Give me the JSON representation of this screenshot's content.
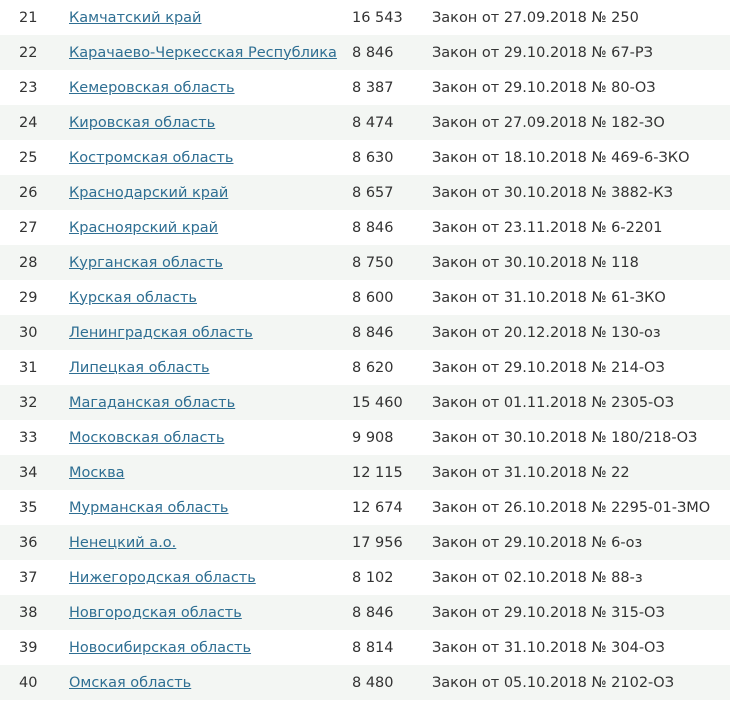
{
  "rows": [
    {
      "n": "21",
      "region": "Камчатский край",
      "amount": "16 543",
      "law": "Закон от 27.09.2018 № 250"
    },
    {
      "n": "22",
      "region": "Карачаево-Черкесская Республика",
      "amount": "8 846",
      "law": "Закон от 29.10.2018 № 67-РЗ"
    },
    {
      "n": "23",
      "region": "Кемеровская область",
      "amount": "8 387",
      "law": "Закон от 29.10.2018 № 80-ОЗ"
    },
    {
      "n": "24",
      "region": "Кировская область",
      "amount": "8 474",
      "law": "Закон от 27.09.2018 № 182-ЗО"
    },
    {
      "n": "25",
      "region": "Костромская область",
      "amount": "8 630",
      "law": "Закон от 18.10.2018 № 469-6-ЗКО"
    },
    {
      "n": "26",
      "region": "Краснодарский край",
      "amount": "8 657",
      "law": "Закон от 30.10.2018 № 3882-КЗ"
    },
    {
      "n": "27",
      "region": "Красноярский край",
      "amount": "8 846",
      "law": "Закон от 23.11.2018 № 6-2201"
    },
    {
      "n": "28",
      "region": "Курганская область",
      "amount": "8 750",
      "law": "Закон от 30.10.2018 № 118"
    },
    {
      "n": "29",
      "region": "Курская область",
      "amount": "8 600",
      "law": "Закон от 31.10.2018 № 61-ЗКО"
    },
    {
      "n": "30",
      "region": "Ленинградская область",
      "amount": "8 846",
      "law": "Закон от 20.12.2018 № 130-оз"
    },
    {
      "n": "31",
      "region": "Липецкая область",
      "amount": "8 620",
      "law": "Закон от 29.10.2018 № 214-ОЗ"
    },
    {
      "n": "32",
      "region": "Магаданская область",
      "amount": "15 460",
      "law": "Закон от 01.11.2018 № 2305-ОЗ"
    },
    {
      "n": "33",
      "region": "Московская область",
      "amount": "9 908",
      "law": "Закон от 30.10.2018 № 180/218-ОЗ"
    },
    {
      "n": "34",
      "region": "Москва",
      "amount": "12 115",
      "law": "Закон от 31.10.2018 № 22"
    },
    {
      "n": "35",
      "region": "Мурманская область",
      "amount": "12 674",
      "law": "Закон от 26.10.2018 № 2295-01-ЗМО"
    },
    {
      "n": "36",
      "region": "Ненецкий а.о.",
      "amount": "17 956",
      "law": "Закон от 29.10.2018 № 6-оз"
    },
    {
      "n": "37",
      "region": "Нижегородская область",
      "amount": "8 102",
      "law": "Закон от 02.10.2018 № 88-з"
    },
    {
      "n": "38",
      "region": "Новгородская область",
      "amount": "8 846",
      "law": "Закон от 29.10.2018 № 315-ОЗ"
    },
    {
      "n": "39",
      "region": "Новосибирская область",
      "amount": "8 814",
      "law": "Закон от 31.10.2018 № 304-ОЗ"
    },
    {
      "n": "40",
      "region": "Омская область",
      "amount": "8 480",
      "law": "Закон от 05.10.2018 № 2102-ОЗ"
    }
  ]
}
